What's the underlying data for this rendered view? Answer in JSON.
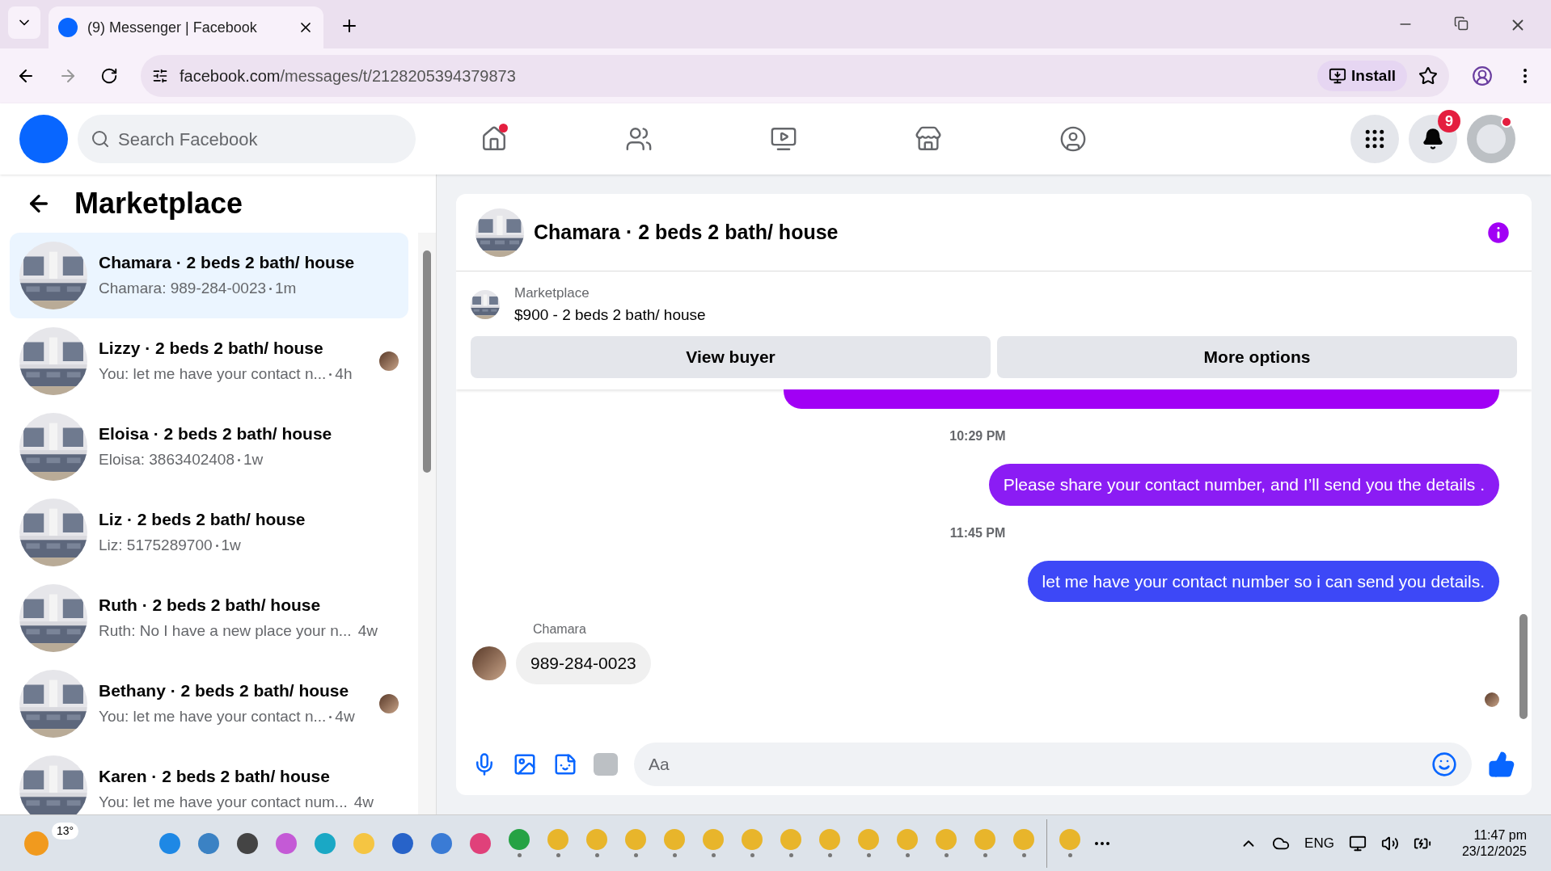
{
  "browser": {
    "tab_title": "(9) Messenger | Facebook",
    "url_host": "facebook.com",
    "url_path": "/messages/t/2128205394379873",
    "install": "Install"
  },
  "nav": {
    "search_placeholder": "Search Facebook",
    "notification_count": "9",
    "items": [
      {
        "kind": "home",
        "selected": false,
        "dot": true
      },
      {
        "kind": "friends",
        "selected": false,
        "dot": false
      },
      {
        "kind": "video",
        "selected": false,
        "dot": false
      },
      {
        "kind": "marketplace",
        "selected": false,
        "dot": false
      },
      {
        "kind": "groups",
        "selected": false,
        "dot": false
      }
    ]
  },
  "sidebar": {
    "title": "Marketplace",
    "conversations": [
      {
        "title": "Chamara · 2 beds 2 bath/ house",
        "preview": "Chamara: 989-284-0023",
        "time": "1m",
        "selected": true,
        "seen": false
      },
      {
        "title": "Lizzy · 2 beds 2 bath/ house",
        "preview": "You: let me have your contact n...",
        "time": "4h",
        "selected": false,
        "seen": true
      },
      {
        "title": "Eloisa · 2 beds 2 bath/ house",
        "preview": "Eloisa: 3863402408",
        "time": "1w",
        "selected": false,
        "seen": false
      },
      {
        "title": "Liz · 2 beds 2 bath/ house",
        "preview": "Liz: 5175289700",
        "time": "1w",
        "selected": false,
        "seen": false
      },
      {
        "title": "Ruth · 2 beds 2 bath/ house",
        "preview": "Ruth: No I have a new place your n...",
        "time": "4w",
        "selected": false,
        "seen": false
      },
      {
        "title": "Bethany · 2 beds 2 bath/ house",
        "preview": "You: let me have your contact n...",
        "time": "4w",
        "selected": false,
        "seen": true
      },
      {
        "title": "Karen · 2 beds 2 bath/ house",
        "preview": "You: let me have your contact num...",
        "time": "4w",
        "selected": false,
        "seen": false
      }
    ]
  },
  "chat": {
    "title": "Chamara · 2 beds 2 bath/ house",
    "listing_label": "Marketplace",
    "listing_title": "$900 - 2 beds 2 bath/ house",
    "buttons": [
      "View buyer",
      "More options"
    ],
    "messages": [
      {
        "kind": "outgoing_cut",
        "color": "#a100f5"
      },
      {
        "kind": "time",
        "text": "10:29 PM"
      },
      {
        "kind": "outgoing",
        "text": "Please share your contact number, and I’ll send you the details .",
        "color": "#8b1cf4"
      },
      {
        "kind": "time",
        "text": "11:45 PM"
      },
      {
        "kind": "outgoing",
        "text": "let me have your contact number so i can send you details.",
        "color": "#3d48f7"
      },
      {
        "kind": "incoming",
        "sender": "Chamara",
        "text": "989-284-0023"
      }
    ],
    "composer_placeholder": "Aa"
  },
  "taskbar": {
    "weather": "13°",
    "language": "ENG",
    "time": "11:47 pm",
    "date": "23/12/2025"
  }
}
